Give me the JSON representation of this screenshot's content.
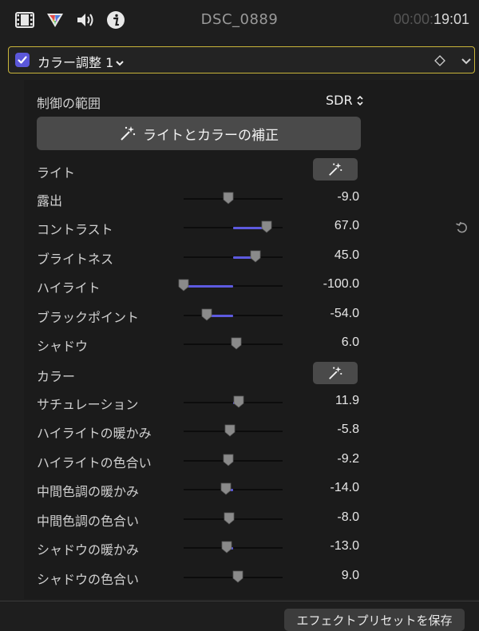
{
  "toolbar": {
    "icons": [
      "film-icon",
      "color-wheel-icon",
      "speaker-icon",
      "info-icon"
    ],
    "title": "DSC_0889",
    "timecode_dim": "00:00:",
    "timecode_lit": "19:01"
  },
  "effect": {
    "name": "カラー調整 1",
    "enabled": true,
    "accent": "#5b57d9",
    "border": "#c9b53a"
  },
  "range": {
    "label": "制御の範囲",
    "value": "SDR"
  },
  "auto_button": "ライトとカラーの補正",
  "sections": {
    "light": "ライト",
    "color": "カラー"
  },
  "params": [
    {
      "label": "露出",
      "value": "-9.0",
      "level": -0.09
    },
    {
      "label": "コントラスト",
      "value": "67.0",
      "level": 0.67
    },
    {
      "label": "ブライトネス",
      "value": "45.0",
      "level": 0.45
    },
    {
      "label": "ハイライト",
      "value": "-100.0",
      "level": -1.0
    },
    {
      "label": "ブラックポイント",
      "value": "-54.0",
      "level": -0.54
    },
    {
      "label": "シャドウ",
      "value": "6.0",
      "level": 0.06
    },
    {
      "label": "サチュレーション",
      "value": "11.9",
      "level": 0.119
    },
    {
      "label": "ハイライトの暖かみ",
      "value": "-5.8",
      "level": -0.058
    },
    {
      "label": "ハイライトの色合い",
      "value": "-9.2",
      "level": -0.092
    },
    {
      "label": "中間色調の暖かみ",
      "value": "-14.0",
      "level": -0.14
    },
    {
      "label": "中間色調の色合い",
      "value": "-8.0",
      "level": -0.08
    },
    {
      "label": "シャドウの暖かみ",
      "value": "-13.0",
      "level": -0.13
    },
    {
      "label": "シャドウの色合い",
      "value": "9.0",
      "level": 0.09
    }
  ],
  "save_button": "エフェクトプリセットを保存"
}
